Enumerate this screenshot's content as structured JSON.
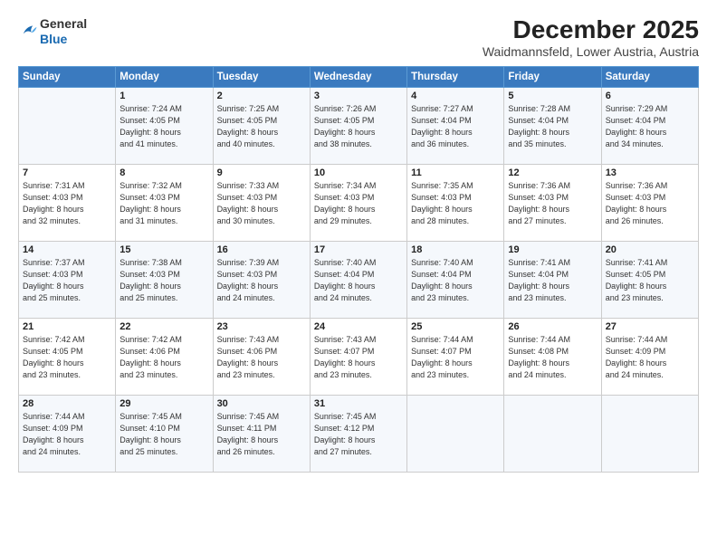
{
  "logo": {
    "general": "General",
    "blue": "Blue"
  },
  "header": {
    "month": "December 2025",
    "location": "Waidmannsfeld, Lower Austria, Austria"
  },
  "columns": [
    "Sunday",
    "Monday",
    "Tuesday",
    "Wednesday",
    "Thursday",
    "Friday",
    "Saturday"
  ],
  "weeks": [
    [
      {
        "day": "",
        "info": ""
      },
      {
        "day": "1",
        "info": "Sunrise: 7:24 AM\nSunset: 4:05 PM\nDaylight: 8 hours\nand 41 minutes."
      },
      {
        "day": "2",
        "info": "Sunrise: 7:25 AM\nSunset: 4:05 PM\nDaylight: 8 hours\nand 40 minutes."
      },
      {
        "day": "3",
        "info": "Sunrise: 7:26 AM\nSunset: 4:05 PM\nDaylight: 8 hours\nand 38 minutes."
      },
      {
        "day": "4",
        "info": "Sunrise: 7:27 AM\nSunset: 4:04 PM\nDaylight: 8 hours\nand 36 minutes."
      },
      {
        "day": "5",
        "info": "Sunrise: 7:28 AM\nSunset: 4:04 PM\nDaylight: 8 hours\nand 35 minutes."
      },
      {
        "day": "6",
        "info": "Sunrise: 7:29 AM\nSunset: 4:04 PM\nDaylight: 8 hours\nand 34 minutes."
      }
    ],
    [
      {
        "day": "7",
        "info": "Sunrise: 7:31 AM\nSunset: 4:03 PM\nDaylight: 8 hours\nand 32 minutes."
      },
      {
        "day": "8",
        "info": "Sunrise: 7:32 AM\nSunset: 4:03 PM\nDaylight: 8 hours\nand 31 minutes."
      },
      {
        "day": "9",
        "info": "Sunrise: 7:33 AM\nSunset: 4:03 PM\nDaylight: 8 hours\nand 30 minutes."
      },
      {
        "day": "10",
        "info": "Sunrise: 7:34 AM\nSunset: 4:03 PM\nDaylight: 8 hours\nand 29 minutes."
      },
      {
        "day": "11",
        "info": "Sunrise: 7:35 AM\nSunset: 4:03 PM\nDaylight: 8 hours\nand 28 minutes."
      },
      {
        "day": "12",
        "info": "Sunrise: 7:36 AM\nSunset: 4:03 PM\nDaylight: 8 hours\nand 27 minutes."
      },
      {
        "day": "13",
        "info": "Sunrise: 7:36 AM\nSunset: 4:03 PM\nDaylight: 8 hours\nand 26 minutes."
      }
    ],
    [
      {
        "day": "14",
        "info": "Sunrise: 7:37 AM\nSunset: 4:03 PM\nDaylight: 8 hours\nand 25 minutes."
      },
      {
        "day": "15",
        "info": "Sunrise: 7:38 AM\nSunset: 4:03 PM\nDaylight: 8 hours\nand 25 minutes."
      },
      {
        "day": "16",
        "info": "Sunrise: 7:39 AM\nSunset: 4:03 PM\nDaylight: 8 hours\nand 24 minutes."
      },
      {
        "day": "17",
        "info": "Sunrise: 7:40 AM\nSunset: 4:04 PM\nDaylight: 8 hours\nand 24 minutes."
      },
      {
        "day": "18",
        "info": "Sunrise: 7:40 AM\nSunset: 4:04 PM\nDaylight: 8 hours\nand 23 minutes."
      },
      {
        "day": "19",
        "info": "Sunrise: 7:41 AM\nSunset: 4:04 PM\nDaylight: 8 hours\nand 23 minutes."
      },
      {
        "day": "20",
        "info": "Sunrise: 7:41 AM\nSunset: 4:05 PM\nDaylight: 8 hours\nand 23 minutes."
      }
    ],
    [
      {
        "day": "21",
        "info": "Sunrise: 7:42 AM\nSunset: 4:05 PM\nDaylight: 8 hours\nand 23 minutes."
      },
      {
        "day": "22",
        "info": "Sunrise: 7:42 AM\nSunset: 4:06 PM\nDaylight: 8 hours\nand 23 minutes."
      },
      {
        "day": "23",
        "info": "Sunrise: 7:43 AM\nSunset: 4:06 PM\nDaylight: 8 hours\nand 23 minutes."
      },
      {
        "day": "24",
        "info": "Sunrise: 7:43 AM\nSunset: 4:07 PM\nDaylight: 8 hours\nand 23 minutes."
      },
      {
        "day": "25",
        "info": "Sunrise: 7:44 AM\nSunset: 4:07 PM\nDaylight: 8 hours\nand 23 minutes."
      },
      {
        "day": "26",
        "info": "Sunrise: 7:44 AM\nSunset: 4:08 PM\nDaylight: 8 hours\nand 24 minutes."
      },
      {
        "day": "27",
        "info": "Sunrise: 7:44 AM\nSunset: 4:09 PM\nDaylight: 8 hours\nand 24 minutes."
      }
    ],
    [
      {
        "day": "28",
        "info": "Sunrise: 7:44 AM\nSunset: 4:09 PM\nDaylight: 8 hours\nand 24 minutes."
      },
      {
        "day": "29",
        "info": "Sunrise: 7:45 AM\nSunset: 4:10 PM\nDaylight: 8 hours\nand 25 minutes."
      },
      {
        "day": "30",
        "info": "Sunrise: 7:45 AM\nSunset: 4:11 PM\nDaylight: 8 hours\nand 26 minutes."
      },
      {
        "day": "31",
        "info": "Sunrise: 7:45 AM\nSunset: 4:12 PM\nDaylight: 8 hours\nand 27 minutes."
      },
      {
        "day": "",
        "info": ""
      },
      {
        "day": "",
        "info": ""
      },
      {
        "day": "",
        "info": ""
      }
    ]
  ]
}
